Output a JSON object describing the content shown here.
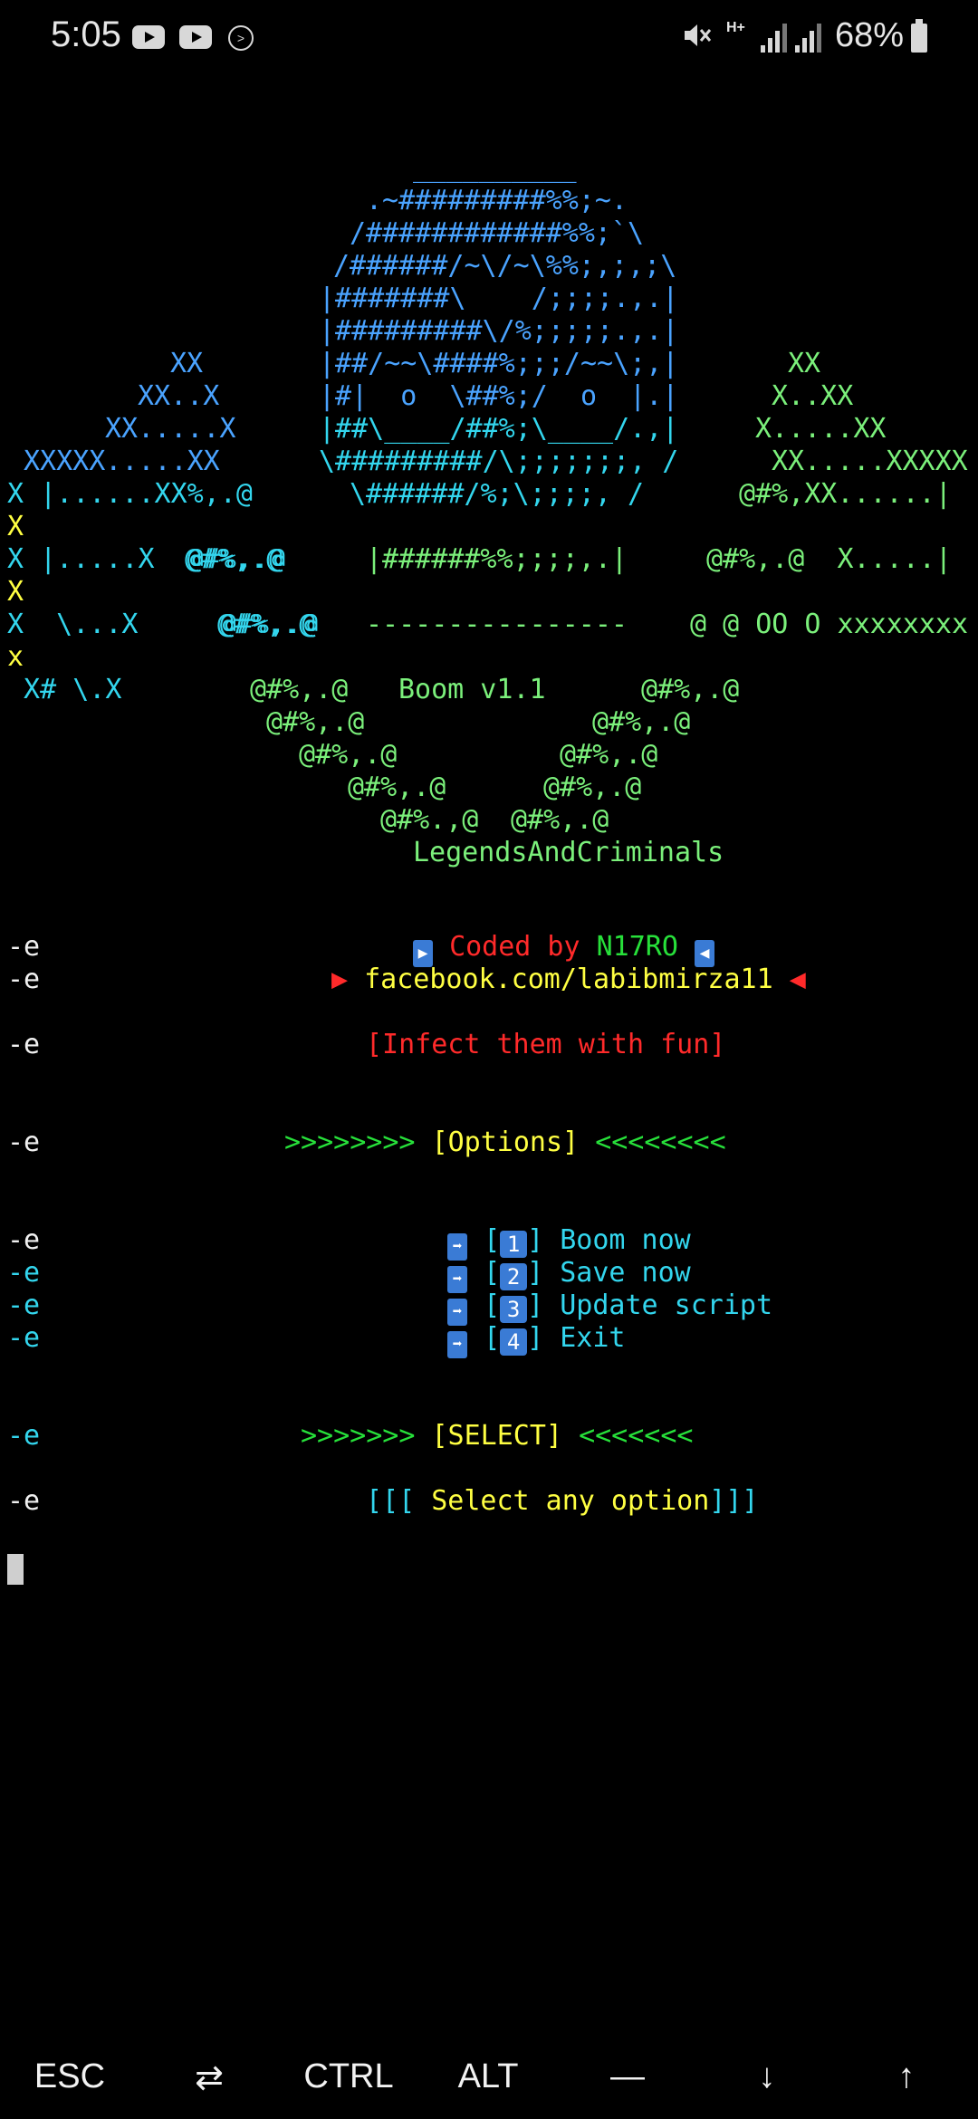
{
  "status_bar": {
    "time": "5:05",
    "network": "H+",
    "battery": "68%",
    "icons": [
      "youtube-icon",
      "youtube-icon",
      "terminal-notification-icon",
      "mute-icon",
      "signal-icon",
      "battery-icon"
    ]
  },
  "banner": {
    "lines": [
      "__________",
      ".~#########%%;~.",
      "/############%%;`\\",
      "/######/~\\/~\\%%;,;,;\\",
      "|#######\\    /;;;;.,.|",
      "|#########\\/%;;;;;.,.|",
      "|##/~~\\####%;;;/~~\\;,|",
      "|#|  o  \\##%;/  o  |.|",
      "|##\\____/##%;\\____/.,|",
      "\\#########/\\;;;;;;;, /",
      "\\######/%;\\;;;;, /",
      "|######%%;;;;,.|",
      "----------------"
    ],
    "left_x": [
      "XX",
      "XX..X",
      "XX.....X",
      "XXXXX.....XX",
      "X |......XX%,.@",
      "X",
      "X |.....X  @#%,.@",
      "X",
      "X  \\...X     @#%,.@",
      "x",
      " X# \\.X"
    ],
    "right_x": [
      "XX",
      "X..XX",
      "X.....XX",
      "XX.....XXXXX",
      "@#%,XX......|",
      "@#%,.@  X.....|",
      "@ @ OO O xxxxxxxx"
    ],
    "version": "Boom v1.1",
    "bones": [
      "@#%,.@",
      "@#%,.@",
      "@#%,.@",
      "@#%,.@",
      "@#%,.@",
      "@#%,.@",
      "@#%.,@",
      "@#%,.@",
      "@#%,.@"
    ],
    "footer": "LegendsAndCriminals"
  },
  "terminal": {
    "prefix": "-e",
    "coded_by": "Coded by",
    "author": "N17RO",
    "facebook": "facebook.com/labibmirza11",
    "tagline": "[Infect them with fun]",
    "options_heading": {
      "left": ">>>>>>>>",
      "label": "[Options]",
      "right": "<<<<<<<<"
    },
    "options": [
      {
        "number": "1",
        "label": "Boom now"
      },
      {
        "number": "2",
        "label": "Save now"
      },
      {
        "number": "3",
        "label": "Update script"
      },
      {
        "number": "4",
        "label": "Exit"
      }
    ],
    "select_heading": {
      "left": ">>>>>>>",
      "label": "[SELECT]",
      "right": "<<<<<<<"
    },
    "prompt": {
      "open": "[[[",
      "text": " Select any option",
      "close": "]]]"
    }
  },
  "extra_keys": [
    "ESC",
    "⇄",
    "CTRL",
    "ALT",
    "—",
    "↓",
    "↑"
  ]
}
